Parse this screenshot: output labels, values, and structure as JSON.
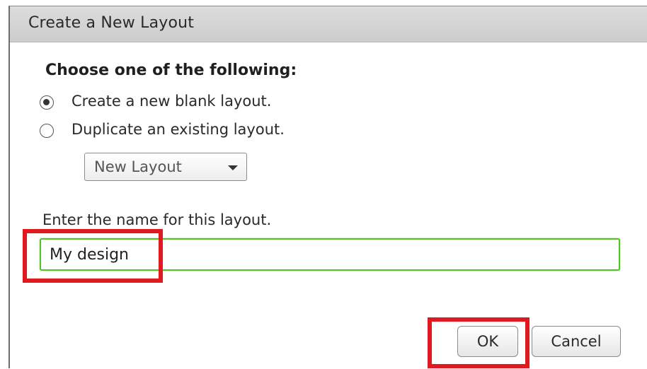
{
  "dialog": {
    "title": "Create a New Layout",
    "heading": "Choose one of the following:",
    "options": [
      {
        "label": "Create a new blank layout.",
        "selected": true
      },
      {
        "label": "Duplicate an existing layout.",
        "selected": false
      }
    ],
    "layout_select": {
      "value": "New Layout"
    },
    "name_prompt": "Enter the name for this layout.",
    "name_input": {
      "value": "My design"
    },
    "ok_label": "OK",
    "cancel_label": "Cancel"
  },
  "colors": {
    "highlight": "#e0191e",
    "input_focus": "#55c12a"
  }
}
